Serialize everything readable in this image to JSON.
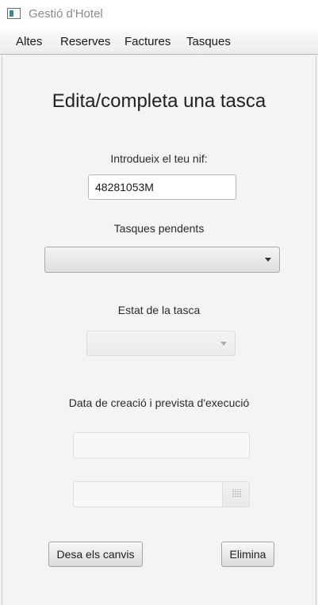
{
  "window": {
    "title": "Gestió d'Hotel"
  },
  "menu": {
    "items": [
      "Altes",
      "Reserves",
      "Factures",
      "Tasques"
    ]
  },
  "form": {
    "heading": "Edita/completa una tasca",
    "nif_label": "Introdueix el teu nif:",
    "nif_value": "48281053M",
    "pending_label": "Tasques pendents",
    "pending_selected": "",
    "status_label": "Estat de la tasca",
    "status_selected": "",
    "dates_label": "Data de creació i prevista d'execució",
    "creation_date": "",
    "planned_date": ""
  },
  "buttons": {
    "save": "Desa els canvis",
    "delete": "Elimina"
  }
}
